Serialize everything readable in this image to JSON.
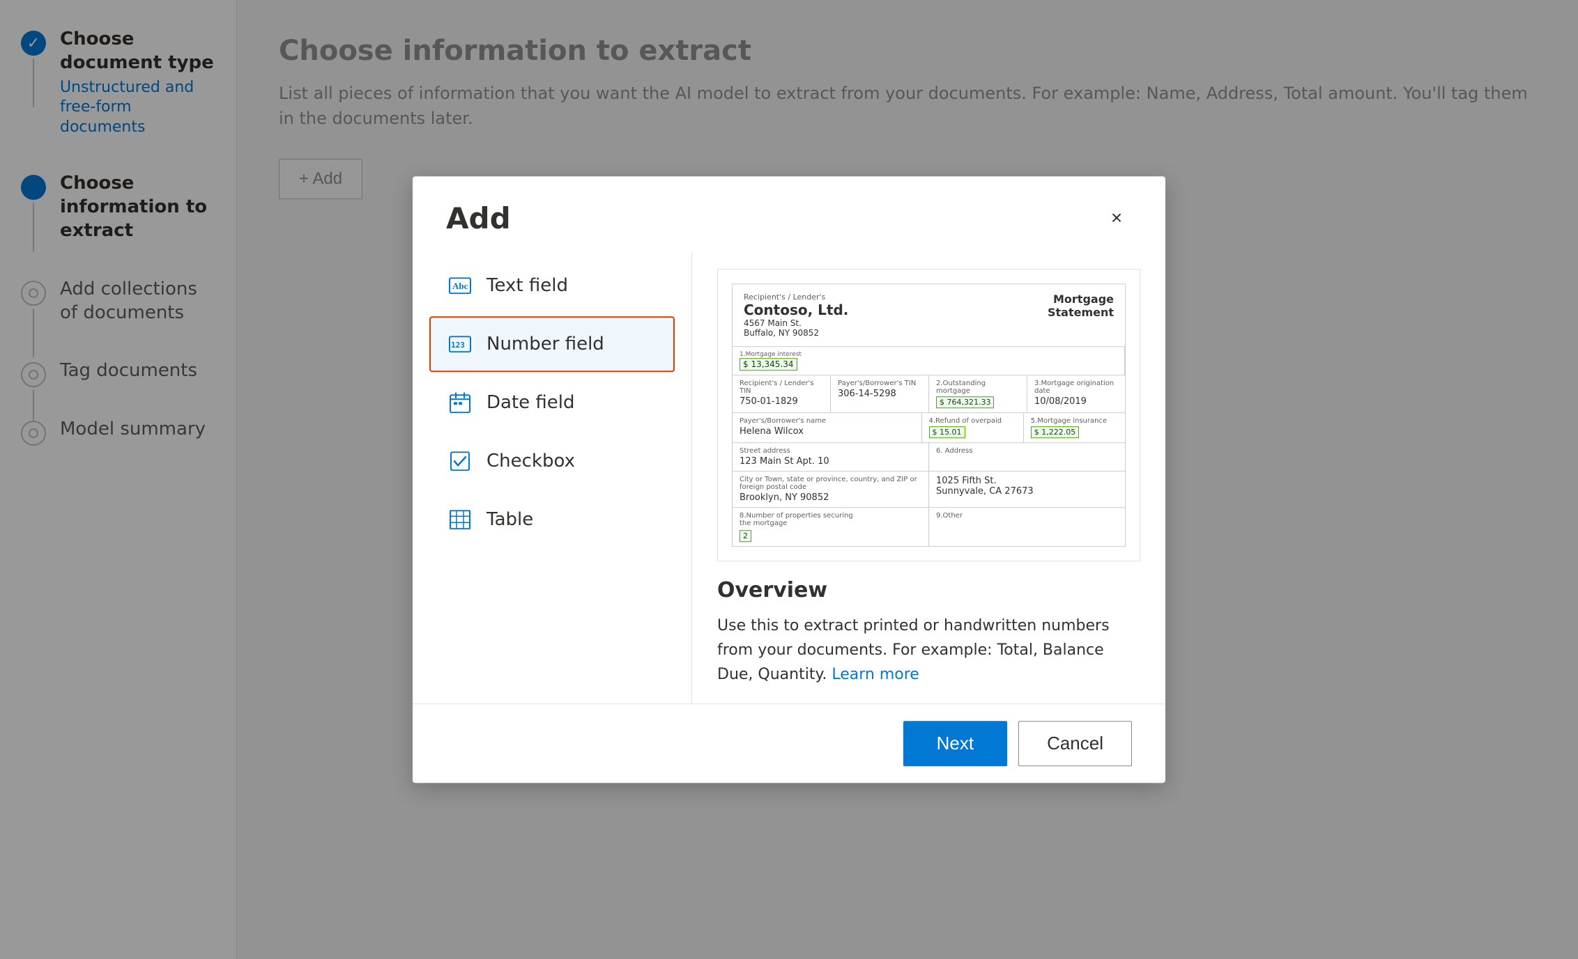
{
  "sidebar": {
    "steps": [
      {
        "id": "choose-document-type",
        "title": "Choose document type",
        "subtitle": "Unstructured and free-form documents",
        "status": "completed",
        "icon": "check"
      },
      {
        "id": "choose-information",
        "title": "Choose information to extract",
        "subtitle": "",
        "status": "active",
        "icon": "dot"
      },
      {
        "id": "add-collections",
        "title": "Add collections of documents",
        "subtitle": "",
        "status": "inactive",
        "icon": "empty"
      },
      {
        "id": "tag-documents",
        "title": "Tag documents",
        "subtitle": "",
        "status": "inactive",
        "icon": "empty"
      },
      {
        "id": "model-summary",
        "title": "Model summary",
        "subtitle": "",
        "status": "inactive",
        "icon": "empty"
      }
    ]
  },
  "main": {
    "title": "Choose information to extract",
    "description": "List all pieces of information that you want the AI model to extract from your documents. For example: Name, Address, Total amount. You'll tag them in the documents later.",
    "add_button_label": "+ Add"
  },
  "dialog": {
    "title": "Add",
    "close_label": "×",
    "field_types": [
      {
        "id": "text-field",
        "label": "Text field",
        "icon": "Abc",
        "selected": false
      },
      {
        "id": "number-field",
        "label": "Number field",
        "icon": "123",
        "selected": true
      },
      {
        "id": "date-field",
        "label": "Date field",
        "icon": "cal",
        "selected": false
      },
      {
        "id": "checkbox",
        "label": "Checkbox",
        "icon": "chk",
        "selected": false
      },
      {
        "id": "table",
        "label": "Table",
        "icon": "tbl",
        "selected": false
      }
    ],
    "preview": {
      "overview_title": "Overview",
      "overview_text": "Use this to extract printed or handwritten numbers from your documents. For example: Total, Balance Due, Quantity.",
      "overview_link_text": "Learn more",
      "mortgage": {
        "recipient_label": "Recipient's / Lender's",
        "company_name": "Contoso, Ltd.",
        "address": "4567 Main St.",
        "city": "Buffalo, NY 90852",
        "statement_type": "Mortgage\nStatement",
        "mortgage_interest_label": "1.Mortgage interest",
        "mortgage_interest_value": "$ 13,345.34",
        "recipient_tin_label": "Recipient's / Lender's TIN",
        "recipient_tin": "750-01-1829",
        "borrower_tin_label": "Payer's/Borrower's TIN",
        "borrower_tin": "306-14-5298",
        "outstanding_label": "2.Outstanding mortgage",
        "outstanding_value": "$ 764,321.33",
        "origination_label": "3.Mortgage origination date",
        "origination_value": "10/08/2019",
        "borrower_name_label": "Payer's/Borrower's name",
        "borrower_name": "Helena Wilcox",
        "refund_label": "4.Refund of overpaid",
        "refund_value": "$ 15.01",
        "insurance_label": "5.Mortgage insurance",
        "insurance_value": "$ 1,222.05",
        "street_label": "Street address",
        "street_value": "123 Main St Apt. 10",
        "address6_label": "6. Address",
        "address6_value": "1025 Fifth St.\nSunnyvale, CA 27673",
        "city_label": "City or Town, state or province, country, and ZIP or foreign postal code",
        "city_value": "Brooklyn, NY 90852",
        "properties_label": "8.Number of properties securing\nthe mortgage",
        "properties_value": "2",
        "other_label": "9.Other"
      }
    },
    "footer": {
      "next_label": "Next",
      "cancel_label": "Cancel"
    }
  }
}
